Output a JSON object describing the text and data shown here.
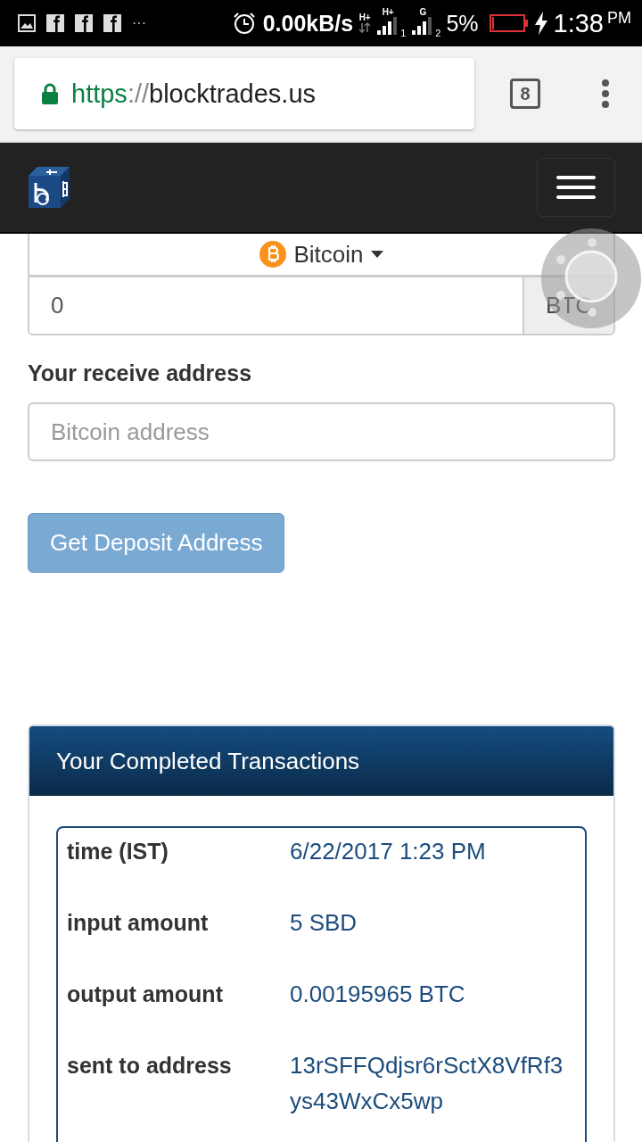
{
  "status_bar": {
    "more": "···",
    "network_speed": "0.00kB/s",
    "sim1_types": [
      "H+",
      "H+"
    ],
    "sim1_label": "1",
    "sim2_type": "G",
    "sim2_label": "2",
    "battery": "5%",
    "charging": true,
    "time": "1:38",
    "time_suffix": "PM"
  },
  "browser": {
    "secure": true,
    "url_scheme": "https",
    "url_separator": "://",
    "url_host": "blocktrades.us",
    "tab_count": "8"
  },
  "form": {
    "currency": "Bitcoin",
    "amount": "0",
    "unit": "BTC",
    "receive_label": "Your receive address",
    "receive_placeholder": "Bitcoin address",
    "submit": "Get Deposit Address"
  },
  "transactions": {
    "title": "Your Completed Transactions",
    "fields": [
      {
        "label": "time (IST)",
        "value": "6/22/2017 1:23 PM"
      },
      {
        "label": "input amount",
        "value": "5 SBD"
      },
      {
        "label": "output amount",
        "value": "0.00195965 BTC"
      },
      {
        "label": "sent to address",
        "value": "13rSFFQdjsr6rSctX8VfRf3ys43WxCx5wp"
      }
    ]
  }
}
